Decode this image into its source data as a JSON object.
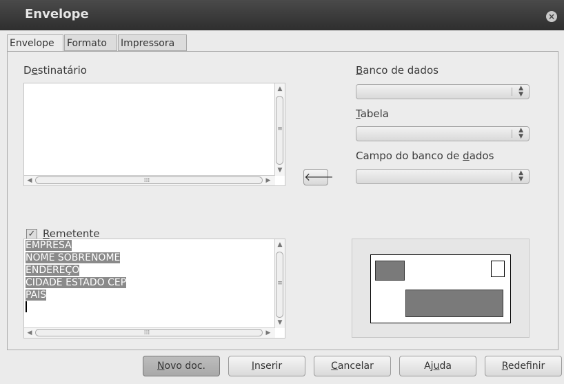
{
  "window": {
    "title": "Envelope",
    "close": "×"
  },
  "tabs": [
    {
      "label": "Envelope",
      "active": true
    },
    {
      "label": "Formato",
      "active": false
    },
    {
      "label": "Impressora",
      "active": false
    }
  ],
  "recipient": {
    "label_pre": "D",
    "label_ul": "e",
    "label_post": "stinatário",
    "value": ""
  },
  "database": {
    "db_label_ul": "B",
    "db_label_rest": "anco de dados",
    "table_label_ul": "T",
    "table_label_rest": "abela",
    "field_label_pre": "Campo do banco de ",
    "field_label_ul": "d",
    "field_label_post": "ados"
  },
  "insert_arrow": "🡐",
  "sender": {
    "checked": true,
    "label_ul": "R",
    "label_rest": "emetente",
    "lines": [
      "EMPRESA",
      "NOME SOBRENOME",
      "ENDEREÇO",
      "CIDADE ESTADO CEP",
      "PAÍS"
    ]
  },
  "scroll_glyphs": {
    "up": "▲",
    "down": "▼",
    "left": "◀",
    "right": "▶",
    "grip_v": "≡",
    "grip_h": "⁞⁞⁞"
  },
  "buttons": {
    "novo_ul": "N",
    "novo_rest": "ovo doc.",
    "inserir_ul": "I",
    "inserir_rest": "nserir",
    "cancelar_ul": "C",
    "cancelar_rest": "ancelar",
    "ajuda_pre": "Aj",
    "ajuda_ul": "u",
    "ajuda_post": "da",
    "redefinir_ul": "R",
    "redefinir_rest": "edefinir"
  }
}
